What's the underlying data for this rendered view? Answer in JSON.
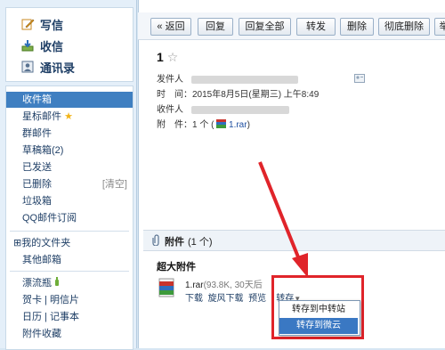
{
  "sidebar": {
    "quick": [
      {
        "label": "写信",
        "icon": "compose-icon"
      },
      {
        "label": "收信",
        "icon": "inbox-download-icon"
      },
      {
        "label": "通讯录",
        "icon": "contacts-icon"
      }
    ],
    "folders": [
      {
        "label": "收件箱",
        "active": true
      },
      {
        "label": "星标邮件",
        "star": "★"
      },
      {
        "label": "群邮件"
      },
      {
        "label": "草稿箱(2)"
      },
      {
        "label": "已发送"
      },
      {
        "label": "已删除",
        "extra": "[清空]"
      },
      {
        "label": "垃圾箱"
      },
      {
        "label": "QQ邮件订阅"
      }
    ],
    "my_folders": {
      "expander": "⊞",
      "label": "我的文件夹"
    },
    "other_mailbox": "其他邮箱",
    "drift_bottle": "漂流瓶",
    "cards": "贺卡 | 明信片",
    "calendar": "日历 | 记事本",
    "attachment_collection": "附件收藏"
  },
  "toolbar": {
    "back": "« 返回",
    "reply": "回复",
    "reply_all": "回复全部",
    "forward": "转发",
    "delete": "删除",
    "delete_permanent": "彻底删除",
    "more": "举"
  },
  "mail": {
    "subject": "1",
    "star": "☆",
    "sender_label": "发件人",
    "time_label": "时　间：",
    "time_value": "2015年8月5日(星期三) 上午8:49",
    "recipient_label": "收件人",
    "attachment_label": "附　件：",
    "attachment_count": "1 个 (",
    "attachment_file": "1.rar",
    "attachment_close": ")"
  },
  "attachments": {
    "header": "附件",
    "count": "(1 个)",
    "big_title": "超大附件",
    "file_name": "1.rar",
    "file_meta": "(93.8K, 30天后",
    "download": "下载",
    "xuanfeng": "旋风下载",
    "preview": "预览",
    "save": "转存",
    "save_options": [
      "转存到中转站",
      "转存到微云"
    ]
  },
  "colors": {
    "accent": "#3f7fc1",
    "highlight": "#e0242a"
  }
}
